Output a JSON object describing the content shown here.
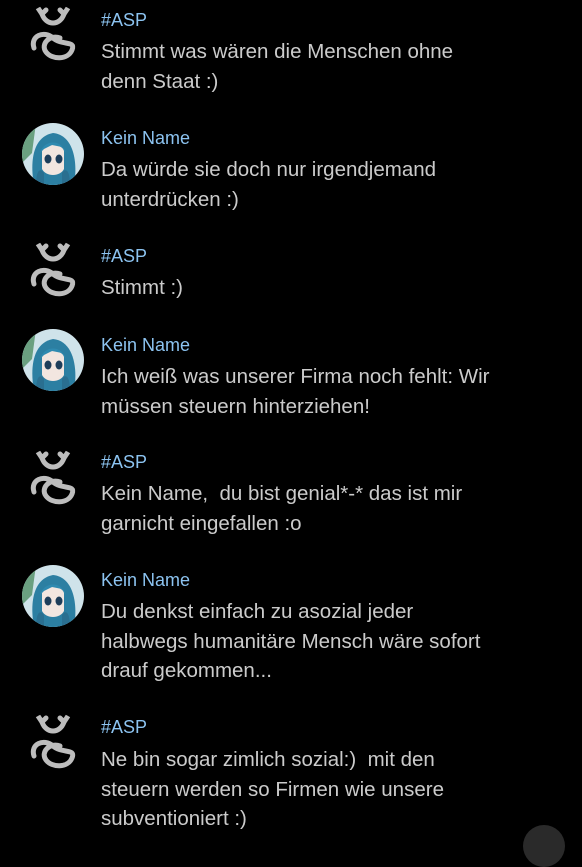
{
  "messages": [
    {
      "user": "#ASP",
      "avatar": "asp-logo-icon",
      "text": "Stimmt was wären die Menschen ohne\ndenn Staat :)"
    },
    {
      "user": "Kein Name",
      "avatar": "anime-girl-avatar",
      "text": "Da würde sie doch nur irgendjemand\nunterdrücken :)"
    },
    {
      "user": "#ASP",
      "avatar": "asp-logo-icon",
      "text": "Stimmt :)"
    },
    {
      "user": "Kein Name",
      "avatar": "anime-girl-avatar",
      "text": "Ich weiß was unserer Firma noch fehlt: Wir\nmüssen steuern hinterziehen!"
    },
    {
      "user": "#ASP",
      "avatar": "asp-logo-icon",
      "text": "Kein Name,  du bist genial*-* das ist mir\ngarnicht eingefallen :o"
    },
    {
      "user": "Kein Name",
      "avatar": "anime-girl-avatar",
      "text": "Du denkst einfach zu asozial jeder\nhalbwegs humanitäre Mensch wäre sofort\ndrauf gekommen..."
    },
    {
      "user": "#ASP",
      "avatar": "asp-logo-icon",
      "text": "Ne bin sogar zimlich sozial:)  mit den\nsteuern werden so Firmen wie unsere\nsubventioniert :)"
    }
  ],
  "colors": {
    "background": "#000000",
    "username": "#8cc3f0",
    "message_text": "#cbcbcb"
  },
  "scroll_button": {
    "icon": "scroll-down-button-icon"
  }
}
